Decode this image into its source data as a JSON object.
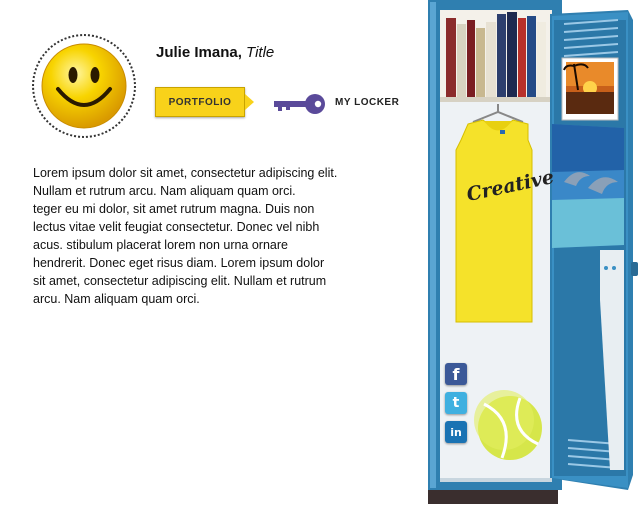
{
  "profile": {
    "name": "Julie Imana,",
    "title": "Title"
  },
  "actions": {
    "portfolio_label": "PORTFOLIO",
    "locker_label": "MY LOCKER"
  },
  "bio": "Lorem ipsum dolor sit amet, consectetur adipiscing elit.\nNullam et rutrum arcu. Nam aliquam quam orci.\nteger eu mi dolor, sit amet rutrum magna. Duis non\nlectus vitae velit feugiat consectetur. Donec vel nibh\nacus. stibulum placerat lorem non urna ornare\n hendrerit. Donec eget risus diam. Lorem ipsum dolor\nsit amet, consectetur adipiscing elit. Nullam et rutrum\narcu. Nam aliquam quam orci.",
  "locker": {
    "shirt_text": "Creative",
    "social": {
      "facebook_glyph": "f",
      "twitter_glyph": "t",
      "linkedin_glyph": "in"
    }
  },
  "colors": {
    "accent_yellow": "#f8d21a",
    "key_purple": "#5a4a9a",
    "locker_blue": "#2f7fb0",
    "smiley_yellow": "#f6c400"
  },
  "icons": [
    "smiley-avatar-icon",
    "key-icon",
    "facebook-icon",
    "twitter-icon",
    "linkedin-icon"
  ]
}
